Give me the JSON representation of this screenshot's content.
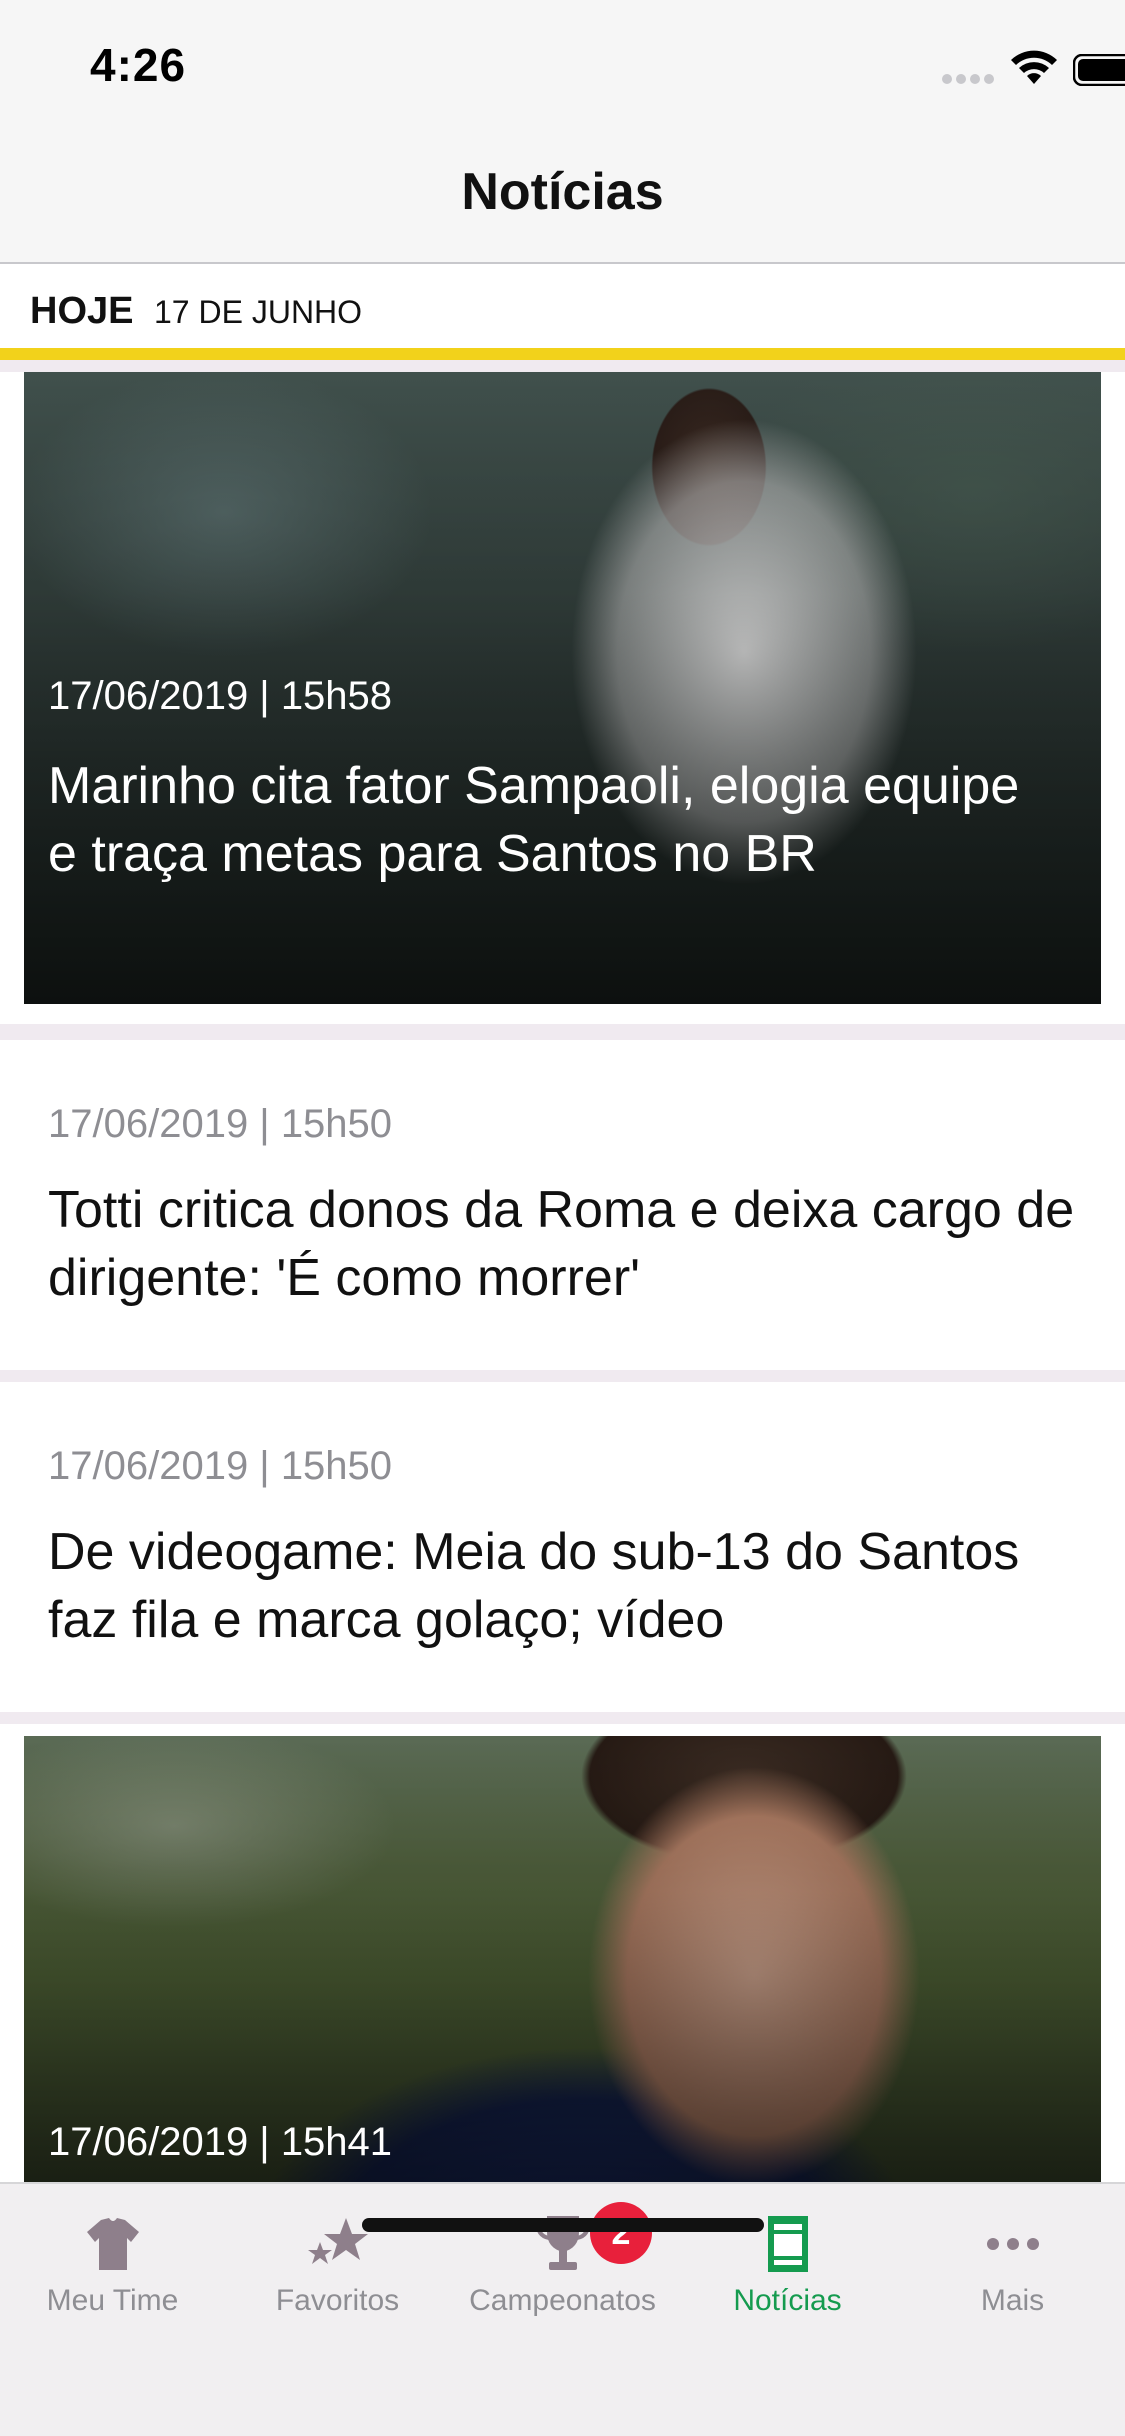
{
  "status_bar": {
    "time": "4:26"
  },
  "nav": {
    "title": "Notícias"
  },
  "date_header": {
    "today_label": "HOJE",
    "date": "17 DE JUNHO"
  },
  "articles": [
    {
      "type": "image",
      "datetime": "17/06/2019 | 15h58",
      "title": "Marinho cita fator Sampaoli, elogia equipe e traça metas para Santos no BR"
    },
    {
      "type": "text",
      "datetime": "17/06/2019 | 15h50",
      "title": "Totti critica donos da Roma e deixa cargo de dirigente: 'É como morrer'"
    },
    {
      "type": "text",
      "datetime": "17/06/2019 | 15h50",
      "title": "De videogame: Meia do sub-13 do Santos faz fila e marca golaço; vídeo"
    },
    {
      "type": "image",
      "datetime": "17/06/2019 | 15h41",
      "title": ""
    }
  ],
  "tab_bar": {
    "tabs": [
      {
        "label": "Meu Time",
        "icon": "shirt-icon",
        "active": false
      },
      {
        "label": "Favoritos",
        "icon": "stars-icon",
        "active": false
      },
      {
        "label": "Campeonatos",
        "icon": "trophy-icon",
        "active": false,
        "badge": "2"
      },
      {
        "label": "Notícias",
        "icon": "newspaper-icon",
        "active": true
      },
      {
        "label": "Mais",
        "icon": "more-dots-icon",
        "active": false
      }
    ]
  },
  "colors": {
    "accent_yellow": "#f2d21b",
    "active_tab": "#159b4f",
    "inactive_tab": "#8e8e93",
    "badge": "#e8203b"
  }
}
